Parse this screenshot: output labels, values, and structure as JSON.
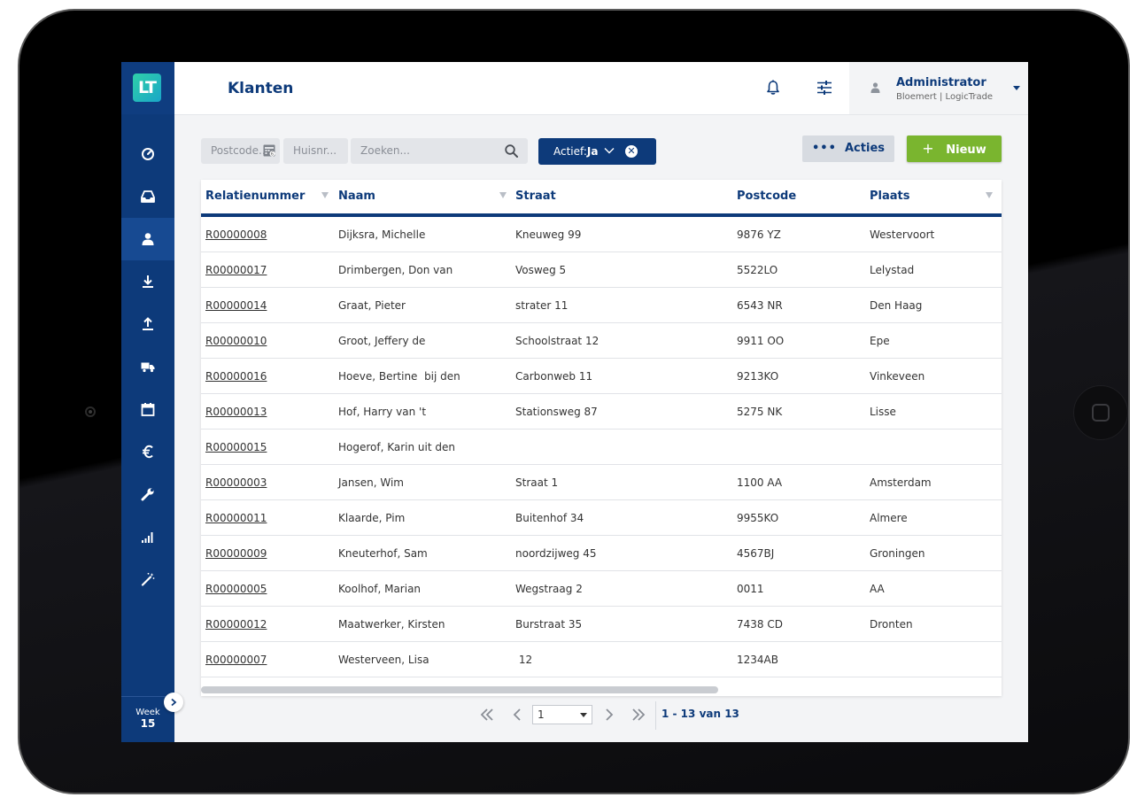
{
  "app": {
    "logo_text": "LT",
    "page_title": "Klanten"
  },
  "user": {
    "name": "Administrator",
    "organization": "Bloemert | LogicTrade"
  },
  "sidebar": {
    "items": [
      {
        "icon": "dashboard-icon",
        "active": false
      },
      {
        "icon": "inbox-icon",
        "active": false
      },
      {
        "icon": "person-icon",
        "active": true
      },
      {
        "icon": "download-icon",
        "active": false
      },
      {
        "icon": "upload-icon",
        "active": false
      },
      {
        "icon": "truck-icon",
        "active": false
      },
      {
        "icon": "calendar-icon",
        "active": false
      },
      {
        "icon": "euro-icon",
        "active": false
      },
      {
        "icon": "wrench-icon",
        "active": false
      },
      {
        "icon": "bar-chart-icon",
        "active": false
      },
      {
        "icon": "magic-wand-icon",
        "active": false
      }
    ],
    "week_label": "Week",
    "week_number": "15"
  },
  "filters": {
    "postcode_placeholder": "Postcode...",
    "huisnr_placeholder": "Huisnr...",
    "search_placeholder": "Zoeken...",
    "actief_label": "Actief:",
    "actief_value": "Ja"
  },
  "actions": {
    "acties_label": "Acties",
    "nieuw_label": "Nieuw"
  },
  "table": {
    "columns": [
      "Relatienummer",
      "Naam",
      "Straat",
      "Postcode",
      "Plaats"
    ],
    "rows": [
      [
        "R00000008",
        "Dijksra, Michelle",
        "Kneuweg 99",
        "9876 YZ",
        "Westervoort"
      ],
      [
        "R00000017",
        "Drimbergen, Don van",
        "Vosweg 5",
        "5522LO",
        "Lelystad"
      ],
      [
        "R00000014",
        "Graat, Pieter",
        "strater 11",
        "6543 NR",
        "Den Haag"
      ],
      [
        "R00000010",
        "Groot, Jeffery de",
        "Schoolstraat 12",
        "9911 OO",
        "Epe"
      ],
      [
        "R00000016",
        "Hoeve, Bertine  bij den",
        "Carbonweb 11",
        "9213KO",
        "Vinkeveen"
      ],
      [
        "R00000013",
        "Hof, Harry van 't",
        "Stationsweg 87",
        "5275 NK",
        "Lisse"
      ],
      [
        "R00000015",
        "Hogerof, Karin uit den",
        "",
        "",
        ""
      ],
      [
        "R00000003",
        "Jansen, Wim",
        "Straat 1",
        "1100 AA",
        "Amsterdam"
      ],
      [
        "R00000011",
        "Klaarde, Pim",
        "Buitenhof 34",
        "9955KO",
        "Almere"
      ],
      [
        "R00000009",
        "Kneuterhof, Sam",
        "noordzijweg 45",
        "4567BJ",
        "Groningen"
      ],
      [
        "R00000005",
        "Koolhof, Marian",
        "Wegstraag 2",
        "0011",
        "AA"
      ],
      [
        "R00000012",
        "Maatwerker, Kirsten",
        "Burstraat 35",
        "7438 CD",
        "Dronten"
      ],
      [
        "R00000007",
        "Westerveen, Lisa",
        " 12",
        "1234AB",
        ""
      ]
    ]
  },
  "pagination": {
    "current_page": "1",
    "info": "1 - 13 van 13"
  },
  "colors": {
    "primary": "#0d3a7a",
    "accent_green": "#7ab52f",
    "background": "#f3f4f6"
  }
}
